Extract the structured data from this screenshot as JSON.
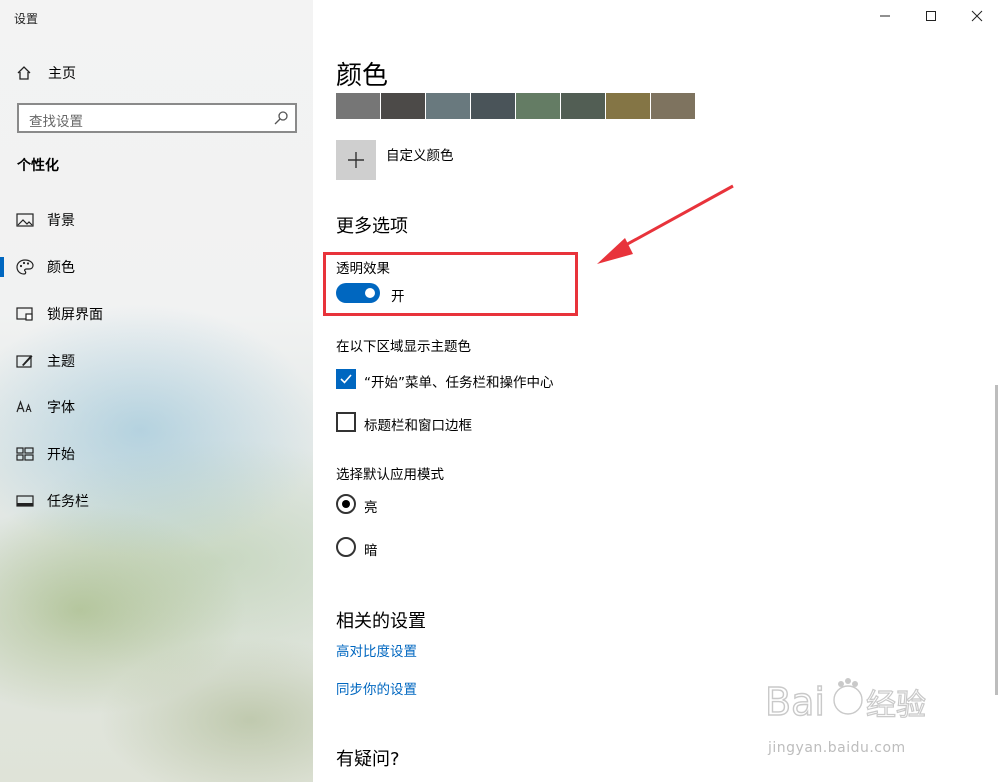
{
  "window": {
    "title": "设置"
  },
  "sidebar": {
    "home_label": "主页",
    "search_placeholder": "查找设置",
    "section_title": "个性化",
    "items": [
      {
        "label": "背景",
        "icon": "picture-icon"
      },
      {
        "label": "颜色",
        "icon": "palette-icon",
        "selected": true
      },
      {
        "label": "锁屏界面",
        "icon": "lock-screen-icon"
      },
      {
        "label": "主题",
        "icon": "theme-brush-icon"
      },
      {
        "label": "字体",
        "icon": "font-icon"
      },
      {
        "label": "开始",
        "icon": "start-grid-icon"
      },
      {
        "label": "任务栏",
        "icon": "taskbar-icon"
      }
    ]
  },
  "main": {
    "title": "颜色",
    "swatches": [
      "#767676",
      "#4c4a48",
      "#69797e",
      "#4a5459",
      "#647c64",
      "#525e54",
      "#847545",
      "#7e735f"
    ],
    "custom_color_label": "自定义颜色",
    "more_options_heading": "更多选项",
    "transparency": {
      "label": "透明效果",
      "state": "开",
      "on": true
    },
    "accent_surfaces_label": "在以下区域显示主题色",
    "checkboxes": [
      {
        "label": "“开始”菜单、任务栏和操作中心",
        "checked": true
      },
      {
        "label": "标题栏和窗口边框",
        "checked": false
      }
    ],
    "app_mode_label": "选择默认应用模式",
    "radios": [
      {
        "label": "亮",
        "selected": true
      },
      {
        "label": "暗",
        "selected": false
      }
    ],
    "related_heading": "相关的设置",
    "links": [
      "高对比度设置",
      "同步你的设置"
    ],
    "faq_heading": "有疑问?"
  },
  "annotation": {
    "color": "#e8333b"
  },
  "accent_color": "#0067c0",
  "watermark": {
    "text": "jingyan.baidu.com"
  }
}
